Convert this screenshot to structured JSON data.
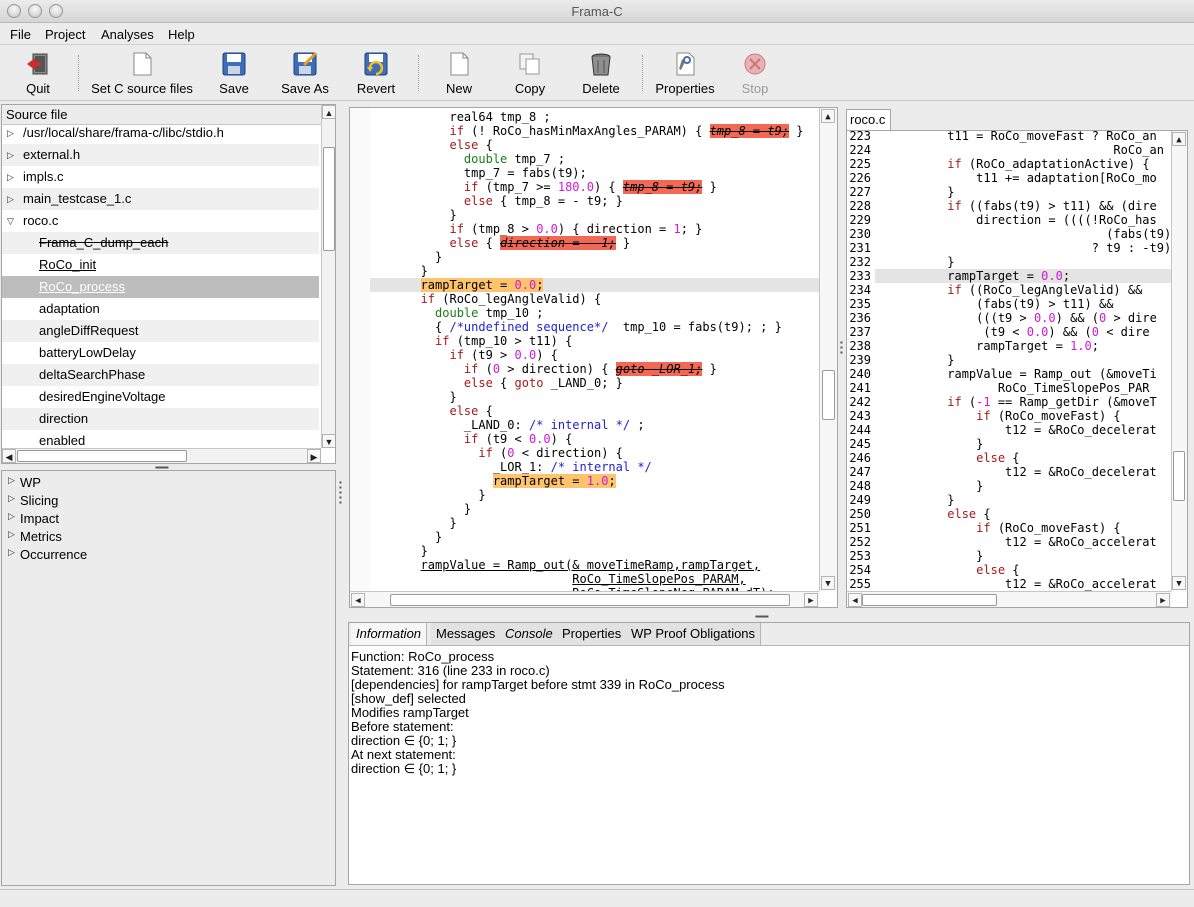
{
  "window": {
    "title": "Frama-C"
  },
  "menu": [
    "File",
    "Project",
    "Analyses",
    "Help"
  ],
  "toolbar": {
    "quit": "Quit",
    "set_c_source": "Set C source files",
    "save": "Save",
    "save_as": "Save As",
    "revert": "Revert",
    "new": "New",
    "copy": "Copy",
    "delete": "Delete",
    "properties": "Properties",
    "stop": "Stop"
  },
  "file_tree": {
    "header": "Source file",
    "items": [
      {
        "label": "/usr/local/share/frama-c/libc/stdio.h"
      },
      {
        "label": "external.h"
      },
      {
        "label": "impls.c"
      },
      {
        "label": "main_testcase_1.c"
      },
      {
        "label": "roco.c"
      },
      {
        "label": "Frama_C_dump_each"
      },
      {
        "label": "RoCo_init"
      },
      {
        "label": "RoCo_process"
      },
      {
        "label": "adaptation"
      },
      {
        "label": "angleDiffRequest"
      },
      {
        "label": "batteryLowDelay"
      },
      {
        "label": "deltaSearchPhase"
      },
      {
        "label": "desiredEngineVoltage"
      },
      {
        "label": "direction"
      },
      {
        "label": "enabled"
      }
    ]
  },
  "plugins": [
    "WP",
    "Slicing",
    "Impact",
    "Metrics",
    "Occurrence"
  ],
  "source_tab": "roco.c",
  "source_lines": [
    {
      "n": "223",
      "t": "          t11 = RoCo_moveFast ? RoCo_an"
    },
    {
      "n": "224",
      "t": "                                 RoCo_an"
    },
    {
      "n": "225",
      "t": "          if (RoCo_adaptationActive) {"
    },
    {
      "n": "226",
      "t": "              t11 += adaptation[RoCo_mo"
    },
    {
      "n": "227",
      "t": "          }"
    },
    {
      "n": "228",
      "t": "          if ((fabs(t9) > t11) && (dire"
    },
    {
      "n": "229",
      "t": "              direction = ((((!RoCo_has"
    },
    {
      "n": "230",
      "t": "                                (fabs(t9)"
    },
    {
      "n": "231",
      "t": "                              ? t9 : -t9)"
    },
    {
      "n": "232",
      "t": "          }"
    },
    {
      "n": "233",
      "t": "          rampTarget = 0.0;"
    },
    {
      "n": "234",
      "t": "          if ((RoCo_legAngleValid) &&"
    },
    {
      "n": "235",
      "t": "              (fabs(t9) > t11) &&"
    },
    {
      "n": "236",
      "t": "              (((t9 > 0.0) && (0 > dire"
    },
    {
      "n": "237",
      "t": "               (t9 < 0.0) && (0 < dire"
    },
    {
      "n": "238",
      "t": "              rampTarget = 1.0;"
    },
    {
      "n": "239",
      "t": "          }"
    },
    {
      "n": "240",
      "t": "          rampValue = Ramp_out (&moveTi"
    },
    {
      "n": "241",
      "t": "                 RoCo_TimeSlopePos_PAR"
    },
    {
      "n": "242",
      "t": "          if (-1 == Ramp_getDir (&moveT"
    },
    {
      "n": "243",
      "t": "              if (RoCo_moveFast) {"
    },
    {
      "n": "244",
      "t": "                  t12 = &RoCo_decelerat"
    },
    {
      "n": "245",
      "t": "              }"
    },
    {
      "n": "246",
      "t": "              else {"
    },
    {
      "n": "247",
      "t": "                  t12 = &RoCo_decelerat"
    },
    {
      "n": "248",
      "t": "              }"
    },
    {
      "n": "249",
      "t": "          }"
    },
    {
      "n": "250",
      "t": "          else {"
    },
    {
      "n": "251",
      "t": "              if (RoCo_moveFast) {"
    },
    {
      "n": "252",
      "t": "                  t12 = &RoCo_accelerat"
    },
    {
      "n": "253",
      "t": "              }"
    },
    {
      "n": "254",
      "t": "              else {"
    },
    {
      "n": "255",
      "t": "                  t12 = &RoCo_accelerat"
    }
  ],
  "info_tabs": [
    "Information",
    "Messages",
    "Console",
    "Properties",
    "WP Proof Obligations"
  ],
  "info_lines": [
    "Function: RoCo_process",
    "Statement: 316 (line 233 in roco.c)",
    "[dependencies] for rampTarget before stmt 339 in RoCo_process",
    "[show_def] selected",
    "Modifies rampTarget",
    "Before statement:",
    "direction ∈ {0; 1; }",
    "At next statement:",
    "direction ∈ {0; 1; }"
  ],
  "colors": {
    "dead_code": "#f36755",
    "highlight": "#fdc46d",
    "keyword": "#a51b1b",
    "type": "#1a7d1a",
    "number": "#d119d1",
    "comment": "#2323c8"
  }
}
